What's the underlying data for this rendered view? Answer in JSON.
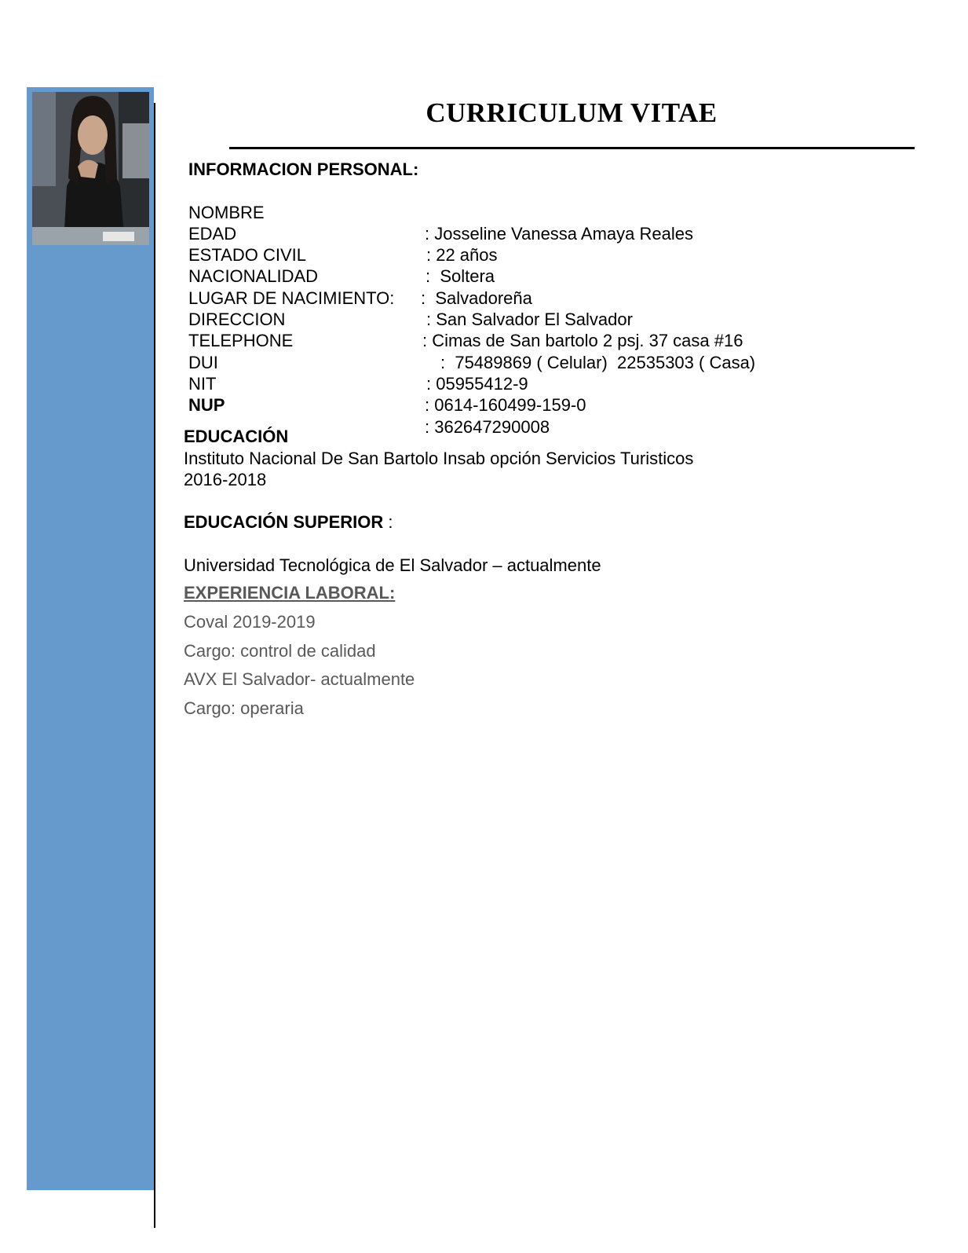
{
  "document": {
    "title": "CURRICULUM VITAE",
    "personal": {
      "heading": "INFORMACION PERSONAL:",
      "fields": [
        {
          "label": "NOMBRE",
          "value": ": Josseline Vanessa Amaya Reales"
        },
        {
          "label": "EDAD",
          "value": ": 22 años"
        },
        {
          "label": "ESTADO CIVIL",
          "value": ":  Soltera"
        },
        {
          "label": "NACIONALIDAD",
          "value": ":  Salvadoreña"
        },
        {
          "label": "LUGAR DE NACIMIENTO:",
          "value": ": San Salvador El Salvador"
        },
        {
          "label": "DIRECCION",
          "value": ": Cimas de San bartolo 2 psj. 37 casa #16"
        },
        {
          "label": "TELEPHONE",
          "value": ":  75489869 ( Celular)  22535303 ( Casa)"
        },
        {
          "label": "DUI",
          "value": ": 05955412-9"
        },
        {
          "label": "NIT",
          "value": ": 0614-160499-159-0"
        },
        {
          "label": "NUP",
          "value": ": 362647290008"
        }
      ]
    },
    "education": {
      "heading": "EDUCACIÓN",
      "institution": "Instituto Nacional De San Bartolo Insab opción Servicios Turisticos",
      "years": "2016-2018"
    },
    "higher_education": {
      "heading": "EDUCACIÓN SUPERIOR",
      "separator": " :",
      "institution": "Universidad Tecnológica de El Salvador – actualmente"
    },
    "experience": {
      "heading": "EXPERIENCIA LABORAL:",
      "items": [
        "Coval 2019-2019",
        "Cargo: control de calidad",
        "AVX El Salvador- actualmente",
        "Cargo: operaria"
      ]
    }
  },
  "colors": {
    "sidebar": "#6699cc",
    "muted_text": "#595959"
  },
  "photo": {
    "icon": "portrait-photo"
  }
}
